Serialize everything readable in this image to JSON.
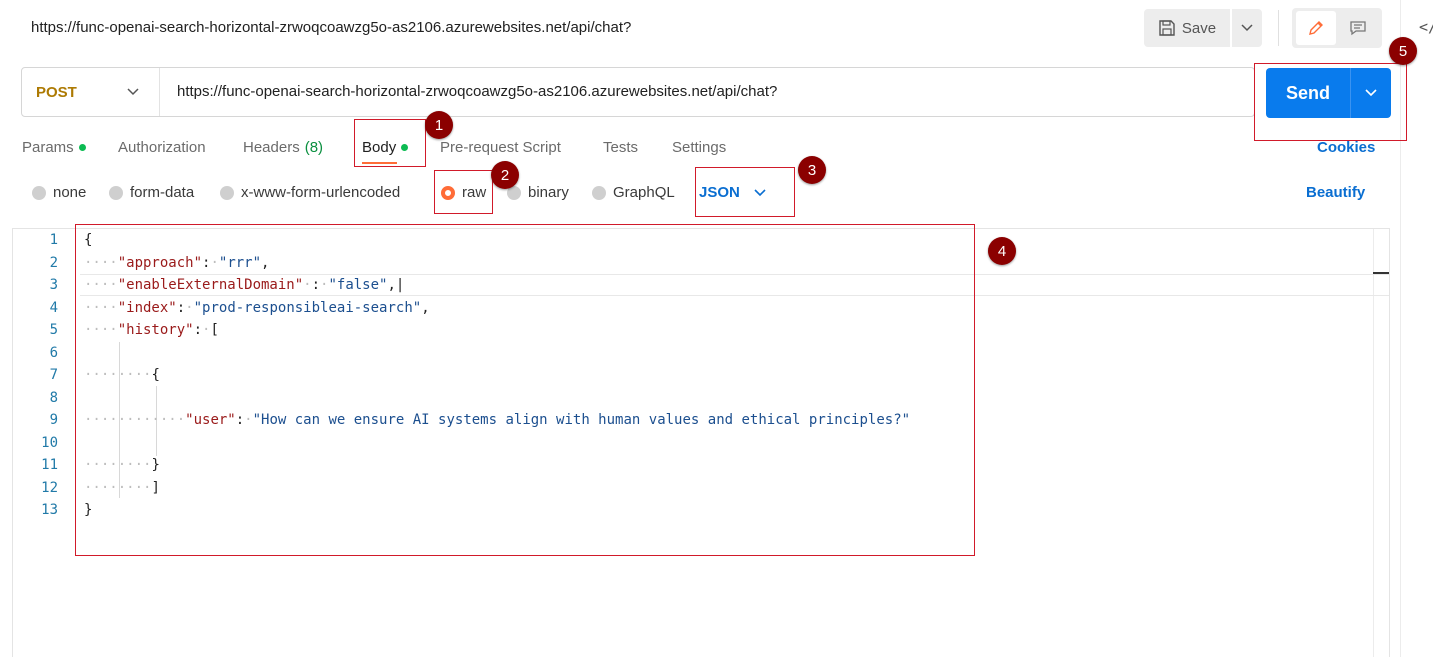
{
  "request": {
    "title": "https://func-openai-search-horizontal-zrwoqcoawzg5o-as2106.azurewebsites.net/api/chat?",
    "method": "POST",
    "url": "https://func-openai-search-horizontal-zrwoqcoawzg5o-as2106.azurewebsites.net/api/chat?"
  },
  "toolbar": {
    "save_label": "Save",
    "send_label": "Send",
    "code_toggle": "</"
  },
  "tabs": {
    "params": "Params",
    "authorization": "Authorization",
    "headers": "Headers",
    "headers_count": "(8)",
    "body": "Body",
    "prerequest": "Pre-request Script",
    "tests": "Tests",
    "settings": "Settings",
    "cookies": "Cookies"
  },
  "body_types": {
    "none": "none",
    "form_data": "form-data",
    "urlencoded": "x-www-form-urlencoded",
    "raw": "raw",
    "binary": "binary",
    "graphql": "GraphQL",
    "language": "JSON",
    "beautify": "Beautify",
    "selected": "raw"
  },
  "editor": {
    "line_numbers": [
      "1",
      "2",
      "3",
      "4",
      "5",
      "6",
      "7",
      "8",
      "9",
      "10",
      "11",
      "12",
      "13"
    ],
    "approach_key": "\"approach\"",
    "approach_val": "\"rrr\"",
    "domain_key": "\"enableExternalDomain\"",
    "domain_val": "\"false\"",
    "index_key": "\"index\"",
    "index_val": "\"prod-responsibleai-search\"",
    "history_key": "\"history\"",
    "user_key": "\"user\"",
    "user_val": "\"How can we ensure AI systems align with human values and ethical principles?\""
  },
  "annotations": [
    "1",
    "2",
    "3",
    "4",
    "5"
  ],
  "colors": {
    "accent": "#ff6c37",
    "send": "#097bed",
    "method": "#ad7a03",
    "annotation": "#d11a2a",
    "badge": "#8b0000"
  }
}
